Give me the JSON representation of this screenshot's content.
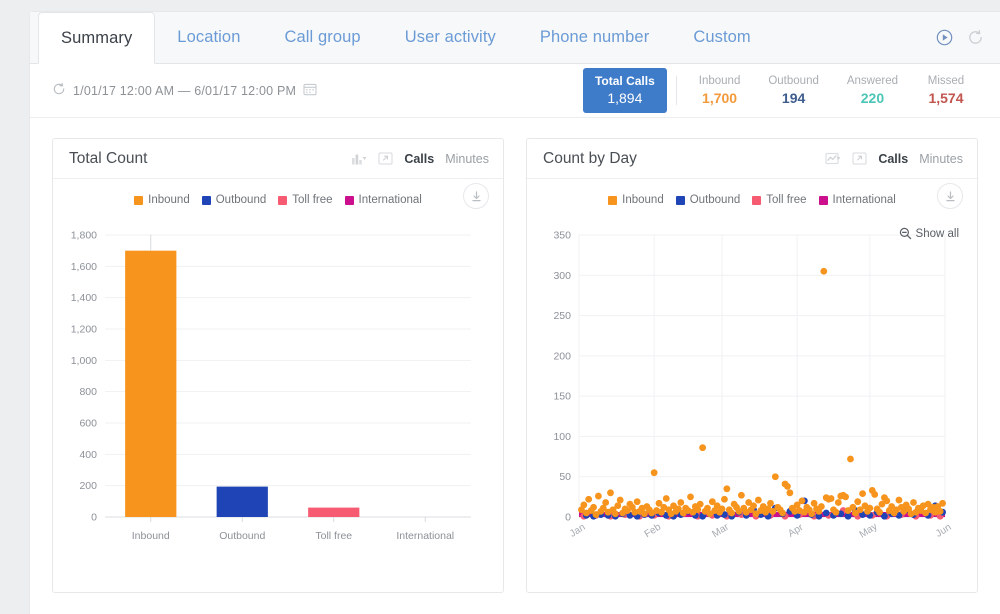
{
  "tabs": [
    {
      "label": "Summary",
      "active": true
    },
    {
      "label": "Location",
      "active": false
    },
    {
      "label": "Call group",
      "active": false
    },
    {
      "label": "User activity",
      "active": false
    },
    {
      "label": "Phone number",
      "active": false
    },
    {
      "label": "Custom",
      "active": false
    }
  ],
  "tabbar_actions": [
    {
      "name": "play-circle-icon",
      "label": "Play"
    },
    {
      "name": "refresh-icon",
      "label": "Refresh"
    }
  ],
  "filter": {
    "refresh_icon": "refresh-icon",
    "date_range": "1/01/17  12:00 AM  —  6/01/17  12:00 PM",
    "calendar_icon": "calendar-icon"
  },
  "kpis": [
    {
      "label": "Total Calls",
      "value": "1,894",
      "color": "#ffffff",
      "primary": true
    },
    {
      "label": "Inbound",
      "value": "1,700",
      "color": "#f2993a",
      "primary": false
    },
    {
      "label": "Outbound",
      "value": "194",
      "color": "#3f5d8f",
      "primary": false
    },
    {
      "label": "Answered",
      "value": "220",
      "color": "#4cc5b6",
      "primary": false
    },
    {
      "label": "Missed",
      "value": "1,574",
      "color": "#c2564f",
      "primary": false
    }
  ],
  "series_colors": {
    "inbound": "#f7941e",
    "outbound": "#1f44b5",
    "tollfree": "#f75b72",
    "international": "#cc0f8c"
  },
  "legend": [
    {
      "label": "Inbound",
      "color": "#f7941e"
    },
    {
      "label": "Outbound",
      "color": "#1f44b5"
    },
    {
      "label": "Toll free",
      "color": "#f75b72"
    },
    {
      "label": "International",
      "color": "#cc0f8c"
    }
  ],
  "left_card": {
    "title": "Total Count",
    "chart_type_icon": "bar-chart-icon",
    "caret_icon": "chevron-down-icon",
    "popout_icon": "popout-icon",
    "download_icon": "download-icon",
    "units": [
      {
        "label": "Calls",
        "active": true
      },
      {
        "label": "Minutes",
        "active": false
      }
    ]
  },
  "right_card": {
    "title": "Count by Day",
    "chart_type_icon": "line-chart-icon",
    "caret_icon": "chevron-down-icon",
    "popout_icon": "popout-icon",
    "download_icon": "download-icon",
    "show_all_label": "Show all",
    "show_all_icon": "zoom-out-icon",
    "units": [
      {
        "label": "Calls",
        "active": true
      },
      {
        "label": "Minutes",
        "active": false
      }
    ]
  },
  "chart_data": [
    {
      "id": "total-count",
      "type": "bar",
      "title": "Total Count",
      "xlabel": "",
      "ylabel": "",
      "categories": [
        "Inbound",
        "Outbound",
        "Toll free",
        "International"
      ],
      "values": [
        1700,
        194,
        60,
        2
      ],
      "colors": [
        "#f7941e",
        "#1f44b5",
        "#f75b72",
        "#cc0f8c"
      ],
      "ylim": [
        0,
        1800
      ],
      "yticks": [
        0,
        200,
        400,
        600,
        800,
        1000,
        1200,
        1400,
        1600,
        1800
      ],
      "ytick_labels": [
        "0",
        "200",
        "400",
        "600",
        "800",
        "1,000",
        "1,200",
        "1,400",
        "1,600",
        "1,800"
      ],
      "grid": true,
      "legend_position": "top"
    },
    {
      "id": "count-by-day",
      "type": "scatter",
      "title": "Count by Day",
      "xlabel": "",
      "ylabel": "",
      "ylim": [
        0,
        350
      ],
      "yticks": [
        0,
        50,
        100,
        150,
        200,
        250,
        300,
        350
      ],
      "ytick_labels": [
        "0",
        "50",
        "100",
        "150",
        "200",
        "250",
        "300",
        "350"
      ],
      "xticks": [
        "Jan",
        "Feb",
        "Mar",
        "Apr",
        "May",
        "Jun"
      ],
      "xlim_days": [
        0,
        151
      ],
      "grid": true,
      "legend_position": "top",
      "series": [
        {
          "name": "Inbound",
          "color": "#f7941e",
          "points": [
            [
              1,
              9
            ],
            [
              2,
              15
            ],
            [
              3,
              5
            ],
            [
              4,
              22
            ],
            [
              5,
              8
            ],
            [
              6,
              12
            ],
            [
              7,
              3
            ],
            [
              8,
              26
            ],
            [
              9,
              7
            ],
            [
              10,
              11
            ],
            [
              11,
              18
            ],
            [
              12,
              6
            ],
            [
              13,
              30
            ],
            [
              14,
              9
            ],
            [
              15,
              4
            ],
            [
              16,
              14
            ],
            [
              17,
              21
            ],
            [
              18,
              5
            ],
            [
              19,
              10
            ],
            [
              20,
              8
            ],
            [
              21,
              16
            ],
            [
              22,
              12
            ],
            [
              23,
              6
            ],
            [
              24,
              19
            ],
            [
              25,
              7
            ],
            [
              26,
              11
            ],
            [
              27,
              4
            ],
            [
              28,
              13
            ],
            [
              29,
              9
            ],
            [
              30,
              5
            ],
            [
              31,
              55
            ],
            [
              32,
              8
            ],
            [
              33,
              17
            ],
            [
              34,
              6
            ],
            [
              35,
              12
            ],
            [
              36,
              23
            ],
            [
              37,
              9
            ],
            [
              38,
              4
            ],
            [
              39,
              14
            ],
            [
              40,
              7
            ],
            [
              41,
              10
            ],
            [
              42,
              18
            ],
            [
              43,
              5
            ],
            [
              44,
              11
            ],
            [
              45,
              8
            ],
            [
              46,
              25
            ],
            [
              47,
              6
            ],
            [
              48,
              13
            ],
            [
              49,
              9
            ],
            [
              50,
              16
            ],
            [
              51,
              86
            ],
            [
              52,
              7
            ],
            [
              53,
              11
            ],
            [
              54,
              4
            ],
            [
              55,
              19
            ],
            [
              56,
              8
            ],
            [
              57,
              14
            ],
            [
              58,
              6
            ],
            [
              59,
              10
            ],
            [
              60,
              22
            ],
            [
              61,
              35
            ],
            [
              62,
              9
            ],
            [
              63,
              5
            ],
            [
              64,
              16
            ],
            [
              65,
              12
            ],
            [
              66,
              7
            ],
            [
              67,
              27
            ],
            [
              68,
              11
            ],
            [
              69,
              6
            ],
            [
              70,
              18
            ],
            [
              71,
              9
            ],
            [
              72,
              14
            ],
            [
              73,
              4
            ],
            [
              74,
              21
            ],
            [
              75,
              8
            ],
            [
              76,
              13
            ],
            [
              77,
              6
            ],
            [
              78,
              10
            ],
            [
              79,
              17
            ],
            [
              80,
              7
            ],
            [
              81,
              50
            ],
            [
              82,
              12
            ],
            [
              83,
              9
            ],
            [
              84,
              5
            ],
            [
              85,
              41
            ],
            [
              86,
              38
            ],
            [
              87,
              30
            ],
            [
              88,
              11
            ],
            [
              89,
              7
            ],
            [
              90,
              15
            ],
            [
              91,
              8
            ],
            [
              92,
              20
            ],
            [
              93,
              6
            ],
            [
              94,
              12
            ],
            [
              95,
              9
            ],
            [
              96,
              4
            ],
            [
              97,
              17
            ],
            [
              98,
              10
            ],
            [
              99,
              7
            ],
            [
              100,
              13
            ],
            [
              101,
              305
            ],
            [
              102,
              24
            ],
            [
              103,
              22
            ],
            [
              104,
              23
            ],
            [
              105,
              9
            ],
            [
              106,
              6
            ],
            [
              107,
              18
            ],
            [
              108,
              26
            ],
            [
              109,
              27
            ],
            [
              110,
              25
            ],
            [
              111,
              8
            ],
            [
              112,
              72
            ],
            [
              113,
              12
            ],
            [
              114,
              5
            ],
            [
              115,
              19
            ],
            [
              116,
              9
            ],
            [
              117,
              29
            ],
            [
              118,
              14
            ],
            [
              119,
              7
            ],
            [
              120,
              11
            ],
            [
              121,
              33
            ],
            [
              122,
              28
            ],
            [
              123,
              10
            ],
            [
              124,
              6
            ],
            [
              125,
              16
            ],
            [
              126,
              24
            ],
            [
              127,
              20
            ],
            [
              128,
              8
            ],
            [
              129,
              13
            ],
            [
              130,
              5
            ],
            [
              131,
              9
            ],
            [
              132,
              21
            ],
            [
              133,
              12
            ],
            [
              134,
              7
            ],
            [
              135,
              15
            ],
            [
              136,
              10
            ],
            [
              137,
              4
            ],
            [
              138,
              18
            ],
            [
              139,
              6
            ],
            [
              140,
              11
            ],
            [
              141,
              8
            ],
            [
              142,
              14
            ],
            [
              143,
              5
            ],
            [
              144,
              16
            ],
            [
              145,
              9
            ],
            [
              146,
              12
            ],
            [
              147,
              6
            ],
            [
              148,
              13
            ],
            [
              149,
              7
            ],
            [
              150,
              17
            ]
          ]
        },
        {
          "name": "Outbound",
          "color": "#1f44b5",
          "points": [
            [
              3,
              2
            ],
            [
              6,
              1
            ],
            [
              9,
              3
            ],
            [
              12,
              2
            ],
            [
              15,
              1
            ],
            [
              18,
              4
            ],
            [
              21,
              2
            ],
            [
              24,
              1
            ],
            [
              27,
              3
            ],
            [
              30,
              2
            ],
            [
              33,
              5
            ],
            [
              36,
              2
            ],
            [
              39,
              1
            ],
            [
              42,
              3
            ],
            [
              45,
              7
            ],
            [
              48,
              2
            ],
            [
              51,
              1
            ],
            [
              54,
              4
            ],
            [
              57,
              2
            ],
            [
              60,
              3
            ],
            [
              63,
              1
            ],
            [
              66,
              6
            ],
            [
              69,
              2
            ],
            [
              72,
              9
            ],
            [
              75,
              3
            ],
            [
              78,
              1
            ],
            [
              81,
              11
            ],
            [
              84,
              4
            ],
            [
              87,
              7
            ],
            [
              90,
              2
            ],
            [
              93,
              20
            ],
            [
              96,
              3
            ],
            [
              99,
              1
            ],
            [
              102,
              5
            ],
            [
              105,
              2
            ],
            [
              108,
              4
            ],
            [
              111,
              1
            ],
            [
              114,
              8
            ],
            [
              117,
              3
            ],
            [
              120,
              2
            ],
            [
              123,
              6
            ],
            [
              126,
              1
            ],
            [
              129,
              4
            ],
            [
              132,
              2
            ],
            [
              135,
              9
            ],
            [
              138,
              3
            ],
            [
              141,
              11
            ],
            [
              144,
              2
            ],
            [
              147,
              14
            ],
            [
              150,
              6
            ]
          ]
        },
        {
          "name": "Toll free",
          "color": "#f75b72",
          "points": [
            [
              2,
              1
            ],
            [
              7,
              2
            ],
            [
              13,
              1
            ],
            [
              19,
              3
            ],
            [
              25,
              1
            ],
            [
              31,
              2
            ],
            [
              37,
              1
            ],
            [
              43,
              4
            ],
            [
              49,
              1
            ],
            [
              55,
              2
            ],
            [
              61,
              1
            ],
            [
              67,
              3
            ],
            [
              73,
              1
            ],
            [
              79,
              2
            ],
            [
              85,
              1
            ],
            [
              91,
              3
            ],
            [
              97,
              1
            ],
            [
              103,
              2
            ],
            [
              109,
              8
            ],
            [
              115,
              1
            ],
            [
              121,
              2
            ],
            [
              127,
              1
            ],
            [
              133,
              3
            ],
            [
              139,
              1
            ],
            [
              145,
              2
            ],
            [
              149,
              1
            ]
          ]
        },
        {
          "name": "International",
          "color": "#cc0f8c",
          "points": [
            [
              1,
              1
            ],
            [
              10,
              1
            ],
            [
              20,
              1
            ],
            [
              30,
              1
            ],
            [
              40,
              1
            ],
            [
              50,
              1
            ],
            [
              60,
              1
            ],
            [
              70,
              1
            ],
            [
              80,
              1
            ],
            [
              90,
              1
            ],
            [
              100,
              1
            ],
            [
              110,
              1
            ],
            [
              120,
              1
            ],
            [
              130,
              1
            ],
            [
              140,
              1
            ],
            [
              150,
              1
            ]
          ]
        }
      ]
    }
  ]
}
